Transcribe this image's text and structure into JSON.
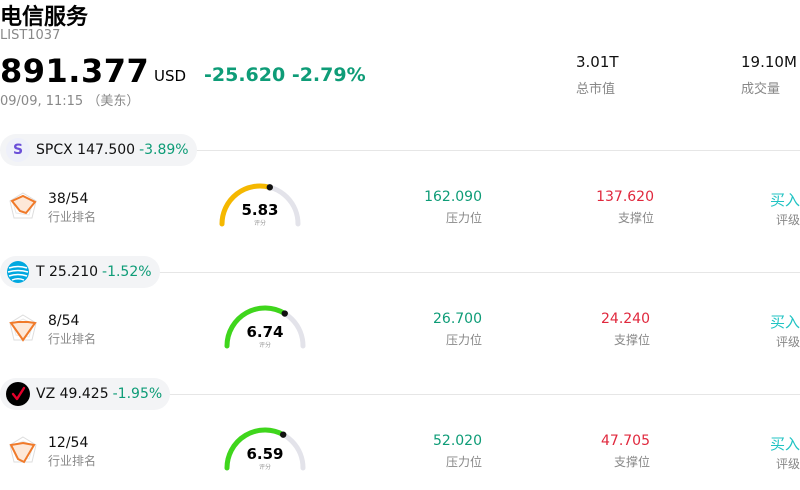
{
  "header": {
    "title": "电信服务",
    "code": "LIST1037",
    "price": "891.377",
    "currency": "USD",
    "change": "-25.620 -2.79%",
    "time": "09/09, 11:15 （美东）",
    "market_cap_value": "3.01T",
    "market_cap_label": "总市值",
    "volume_value": "19.10M",
    "volume_label": "成交量"
  },
  "colors": {
    "positive_green": "#0e9c77",
    "negative_red": "#e0283d",
    "rating_teal": "#20c3c3",
    "gauge_yellow": "#f5b800",
    "gauge_green": "#3fd61c"
  },
  "stocks": [
    {
      "ticker": "SPCX",
      "price": "147.500",
      "change": "-3.89%",
      "logo_icon": "spcx-logo-icon",
      "logo_text": "S",
      "rank": "38/54",
      "rank_label": "行业排名",
      "score": "5.83",
      "score_value": 5.83,
      "score_sub": "评分",
      "resistance": "162.090",
      "resistance_label": "压力位",
      "support": "137.620",
      "support_label": "支撑位",
      "rating": "买入",
      "rating_label": "评级"
    },
    {
      "ticker": "T",
      "price": "25.210",
      "change": "-1.52%",
      "logo_icon": "att-globe-logo-icon",
      "logo_text": "",
      "rank": "8/54",
      "rank_label": "行业排名",
      "score": "6.74",
      "score_value": 6.74,
      "score_sub": "评分",
      "resistance": "26.700",
      "resistance_label": "压力位",
      "support": "24.240",
      "support_label": "支撑位",
      "rating": "买入",
      "rating_label": "评级"
    },
    {
      "ticker": "VZ",
      "price": "49.425",
      "change": "-1.95%",
      "logo_icon": "verizon-check-logo-icon",
      "logo_text": "",
      "rank": "12/54",
      "rank_label": "行业排名",
      "score": "6.59",
      "score_value": 6.59,
      "score_sub": "评分",
      "resistance": "52.020",
      "resistance_label": "压力位",
      "support": "47.705",
      "support_label": "支撑位",
      "rating": "买入",
      "rating_label": "评级"
    }
  ]
}
